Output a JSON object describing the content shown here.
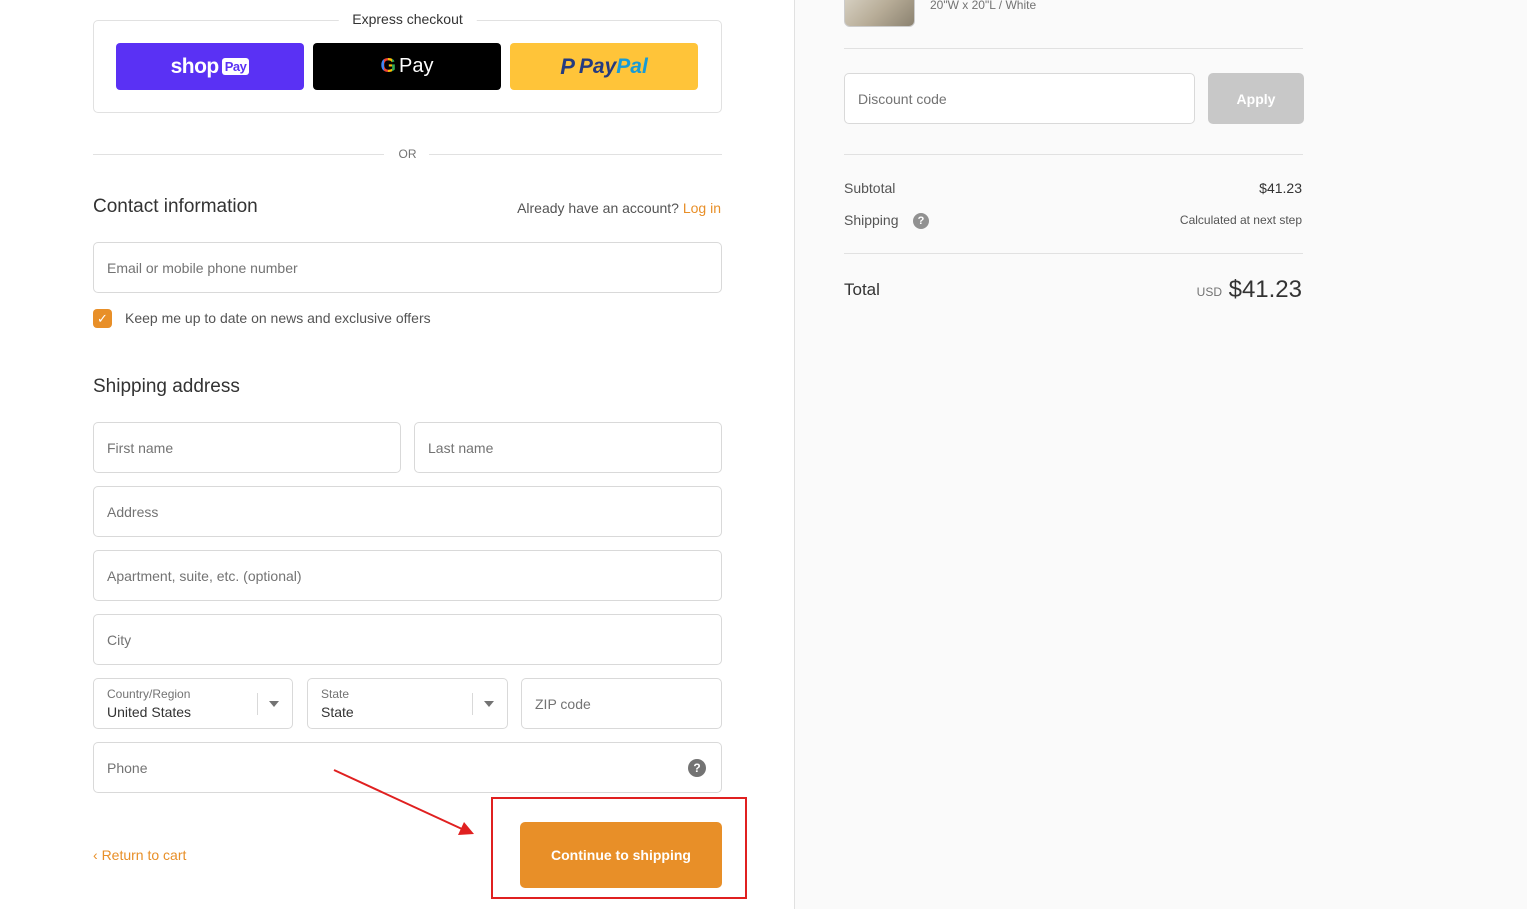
{
  "express": {
    "title": "Express checkout",
    "shop_pay": {
      "label": "shop",
      "badge": "Pay"
    },
    "google_pay": {
      "g": "G",
      "label": "Pay"
    },
    "paypal": {
      "p": "P",
      "pay": "Pay",
      "pal": "Pal"
    },
    "or": "OR"
  },
  "contact": {
    "title": "Contact information",
    "account_prompt": "Already have an account?",
    "login_link": "Log in",
    "email_placeholder": "Email or mobile phone number",
    "newsletter_label": "Keep me up to date on news and exclusive offers",
    "newsletter_checked": true
  },
  "shipping": {
    "title": "Shipping address",
    "first_name_placeholder": "First name",
    "last_name_placeholder": "Last name",
    "address_placeholder": "Address",
    "apartment_placeholder": "Apartment, suite, etc. (optional)",
    "city_placeholder": "City",
    "country_label": "Country/Region",
    "country_value": "United States",
    "state_label": "State",
    "state_value": "State",
    "zip_placeholder": "ZIP code",
    "phone_placeholder": "Phone",
    "help_glyph": "?"
  },
  "actions": {
    "return_label": "Return to cart",
    "continue_label": "Continue to shipping"
  },
  "summary": {
    "variant": "20\"W x 20\"L / White",
    "discount_placeholder": "Discount code",
    "apply_label": "Apply",
    "subtotal_label": "Subtotal",
    "subtotal_value": "$41.23",
    "shipping_label": "Shipping",
    "shipping_note": "Calculated at next step",
    "total_label": "Total",
    "currency": "USD",
    "total_value": "$41.23"
  },
  "colors": {
    "accent": "#e88f28",
    "annotation": "#e02020",
    "shop_pay": "#5a31f4",
    "paypal": "#ffc439"
  }
}
